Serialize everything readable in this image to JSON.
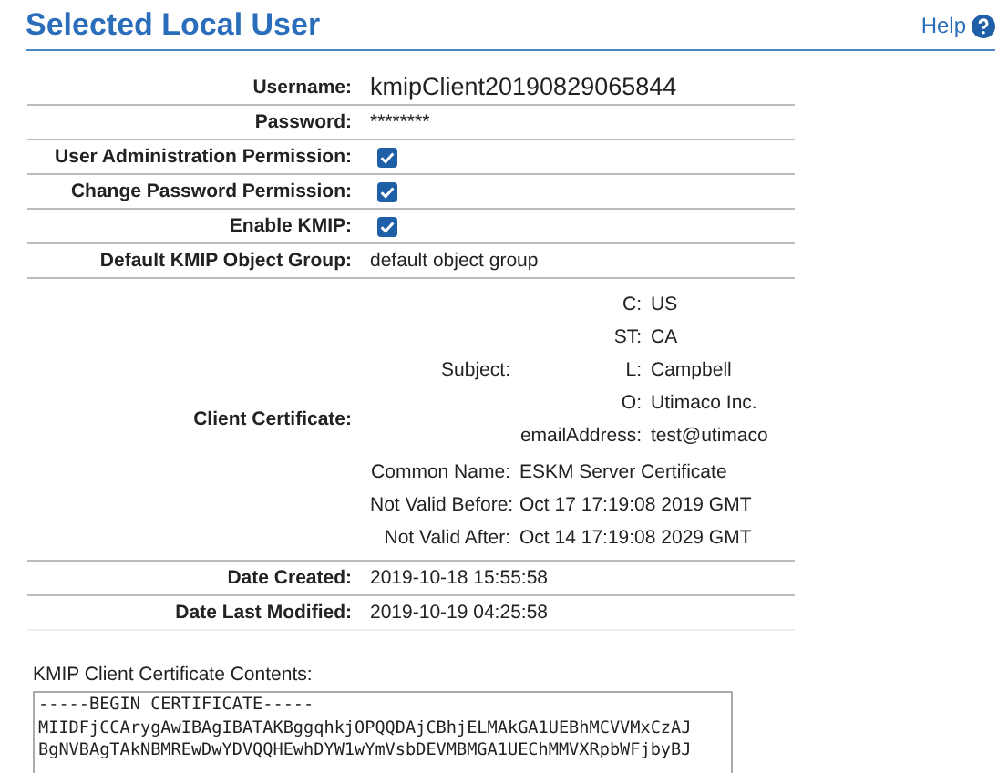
{
  "header": {
    "title": "Selected Local User",
    "help": "Help"
  },
  "rows": [
    {
      "kind": "large",
      "label": "Username:",
      "value": "kmipClient20190829065844"
    },
    {
      "kind": "text",
      "label": "Password:",
      "value": "********"
    },
    {
      "kind": "check",
      "label": "User Administration Permission:",
      "checked": true
    },
    {
      "kind": "check",
      "label": "Change Password Permission:",
      "checked": true
    },
    {
      "kind": "check",
      "label": "Enable KMIP:",
      "checked": true
    },
    {
      "kind": "text",
      "label": "Default KMIP Object Group:",
      "value": "default object group"
    },
    {
      "kind": "cert",
      "label": "Client Certificate:",
      "subject_label": "Subject:",
      "subject": [
        {
          "key": "C:",
          "value": "US"
        },
        {
          "key": "ST:",
          "value": "CA"
        },
        {
          "key": "L:",
          "value": "Campbell"
        },
        {
          "key": "O:",
          "value": "Utimaco Inc."
        },
        {
          "key": "emailAddress:",
          "value": "test@utimaco"
        }
      ],
      "fields": [
        {
          "key": "Common Name:",
          "value": "ESKM Server Certificate"
        },
        {
          "key": "Not Valid Before:",
          "value": "Oct 17 17:19:08 2019 GMT"
        },
        {
          "key": "Not Valid After:",
          "value": "Oct 14 17:19:08 2029 GMT"
        }
      ]
    },
    {
      "kind": "text",
      "label": "Date Created:",
      "value": "2019-10-18 15:55:58"
    },
    {
      "kind": "text",
      "label": "Date Last Modified:",
      "value": "2019-10-19 04:25:58"
    }
  ],
  "contents": {
    "label": "KMIP Client Certificate Contents:",
    "lines": [
      "-----BEGIN CERTIFICATE-----",
      "MIIDFjCCArygAwIBAgIBATAKBggqhkjOPQQDAjCBhjELMAkGA1UEBhMCVVMxCzAJ",
      "BgNVBAgTAkNBMREwDwYDVQQHEwhDYW1wYmVsbDEVMBMGA1UEChMMVXRpbWFjbyBJ"
    ]
  }
}
